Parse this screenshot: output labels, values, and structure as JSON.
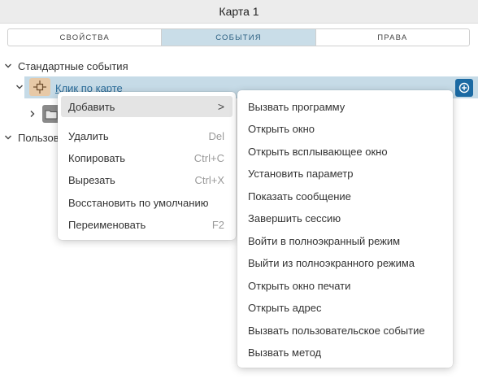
{
  "window": {
    "title": "Карта 1"
  },
  "tabs": [
    {
      "label": "СВОЙСТВА",
      "active": false
    },
    {
      "label": "СОБЫТИЯ",
      "active": true
    },
    {
      "label": "ПРАВА",
      "active": false
    }
  ],
  "tree": {
    "standard_events": "Стандартные события",
    "click_event": "Клик по карте",
    "user_events": "Пользов"
  },
  "context_menu": {
    "items": [
      {
        "label": "Добавить",
        "shortcut": "",
        "submenu_arrow": ">"
      },
      {
        "label": "Удалить",
        "shortcut": "Del"
      },
      {
        "label": "Копировать",
        "shortcut": "Ctrl+C"
      },
      {
        "label": "Вырезать",
        "shortcut": "Ctrl+X"
      },
      {
        "label": "Восстановить по умолчанию",
        "shortcut": ""
      },
      {
        "label": "Переименовать",
        "shortcut": "F2"
      }
    ]
  },
  "submenu": {
    "items": [
      "Вызвать программу",
      "Открыть окно",
      "Открыть всплывающее окно",
      "Установить параметр",
      "Показать сообщение",
      "Завершить сессию",
      "Войти в полноэкранный режим",
      "Выйти из полноэкранного режима",
      "Открыть окно печати",
      "Открыть адрес",
      "Вызвать пользовательское событие",
      "Вызвать метод"
    ]
  },
  "colors": {
    "accent": "#1b6aa3",
    "selected_row": "#c6dbe7",
    "active_tab": "#c9dde8",
    "event_icon_bg": "#e7c9a7"
  },
  "icons": {
    "expand": "chevron-down-icon",
    "collapse": "chevron-right-icon",
    "event": "event-node-icon",
    "add": "plus-circle-icon",
    "folder": "folder-icon"
  }
}
